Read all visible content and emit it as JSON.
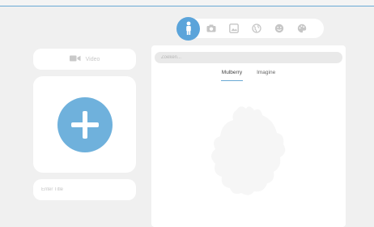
{
  "toolbar": {
    "icons": [
      "person-icon",
      "camera-icon",
      "image-icon",
      "globe-icon",
      "smiley-icon",
      "palette-icon"
    ],
    "active_icon": "person-icon",
    "active_color": "#5ba4da"
  },
  "left": {
    "video_label": "Video",
    "title_placeholder": "Enter Title",
    "add_color": "#6fb1dc"
  },
  "panel": {
    "search_placeholder": "Zoeken...",
    "tabs": [
      {
        "label": "Mulberry",
        "active": true
      },
      {
        "label": "Imagine",
        "active": false
      }
    ]
  }
}
